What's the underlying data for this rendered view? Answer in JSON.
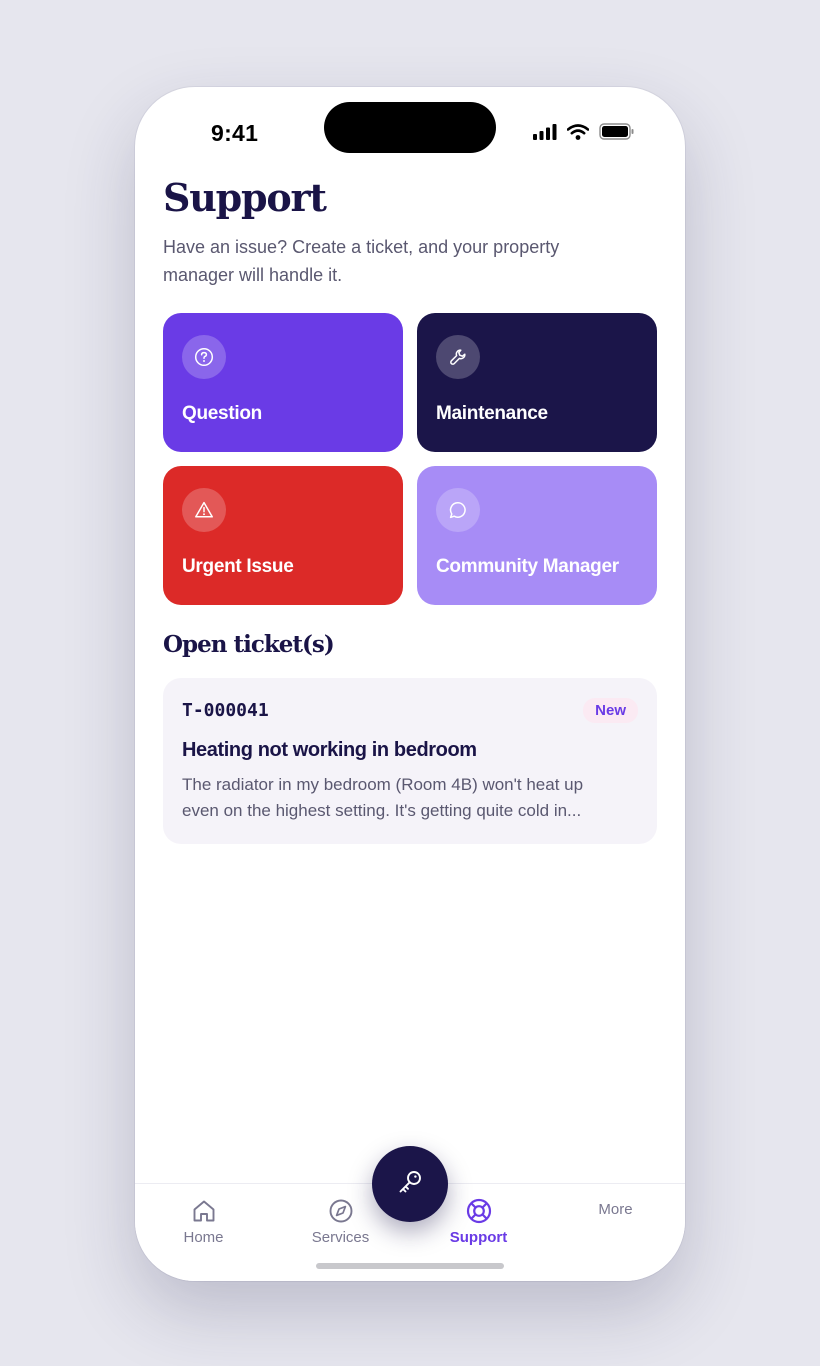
{
  "status_bar": {
    "time": "9:41"
  },
  "header": {
    "title": "Support",
    "subtitle": "Have an issue? Create a ticket, and your property manager will handle it."
  },
  "categories": [
    {
      "label": "Question",
      "icon": "question-circle-icon",
      "color": "#6a3be6"
    },
    {
      "label": "Maintenance",
      "icon": "wrench-icon",
      "color": "#1b1549"
    },
    {
      "label": "Urgent Issue",
      "icon": "warning-triangle-icon",
      "color": "#dc2a28"
    },
    {
      "label": "Community Manager",
      "icon": "chat-bubble-icon",
      "color": "#a78cf6"
    }
  ],
  "open_tickets": {
    "section_title": "Open ticket(s)",
    "items": [
      {
        "id": "T-000041",
        "status": "New",
        "title": "Heating not working in bedroom",
        "description": "The radiator in my bedroom (Room 4B) won't heat up even on the highest setting. It's getting quite cold in..."
      }
    ]
  },
  "tab_bar": {
    "items": [
      {
        "label": "Home",
        "icon": "home-icon",
        "active": false
      },
      {
        "label": "Services",
        "icon": "compass-icon",
        "active": false
      },
      {
        "label": "Support",
        "icon": "lifebuoy-icon",
        "active": true
      },
      {
        "label": "More",
        "icon": "",
        "active": false
      }
    ],
    "fab_icon": "key-icon"
  },
  "colors": {
    "accent": "#6a3be6",
    "navy": "#1b1549",
    "urgent": "#dc2a28",
    "lavender": "#a78cf6"
  }
}
